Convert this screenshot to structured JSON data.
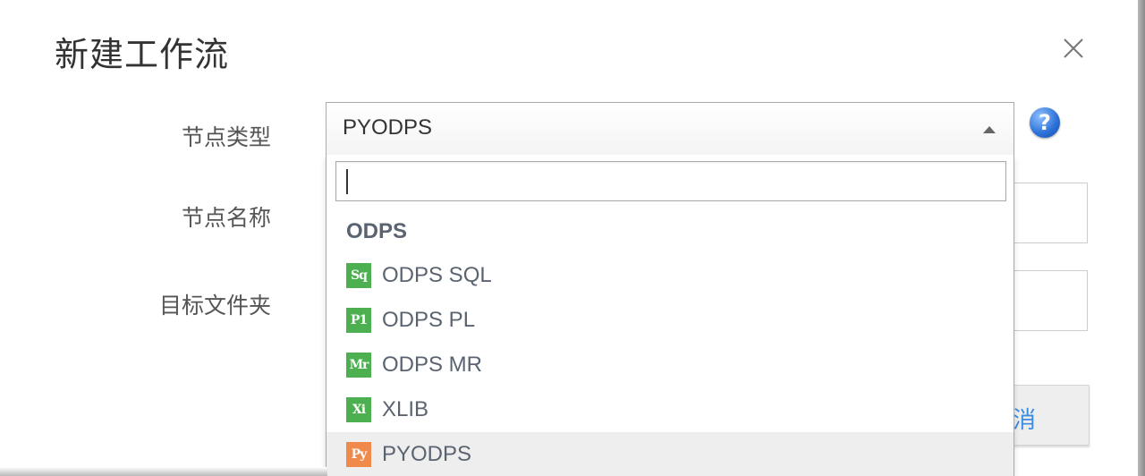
{
  "dialog": {
    "title": "新建工作流"
  },
  "form": {
    "node_type_label": "节点类型",
    "node_name_label": "节点名称",
    "target_folder_label": "目标文件夹",
    "help_glyph": "?"
  },
  "select": {
    "value": "PYODPS",
    "search_value": ""
  },
  "dropdown": {
    "group_label": "ODPS",
    "options": [
      {
        "label": "ODPS SQL",
        "icon": "Sq",
        "icon_name": "odps-sql-icon",
        "color": "#4caf50"
      },
      {
        "label": "ODPS PL",
        "icon": "P1",
        "icon_name": "odps-pl-icon",
        "color": "#4caf50"
      },
      {
        "label": "ODPS MR",
        "icon": "Mr",
        "icon_name": "odps-mr-icon",
        "color": "#4caf50"
      },
      {
        "label": "XLIB",
        "icon": "Xi",
        "icon_name": "xlib-icon",
        "color": "#4caf50"
      },
      {
        "label": "PYODPS",
        "icon": "Py",
        "icon_name": "pyodps-icon",
        "color": "#f08a4b"
      }
    ]
  },
  "background": {
    "cancel_partial": "消"
  }
}
